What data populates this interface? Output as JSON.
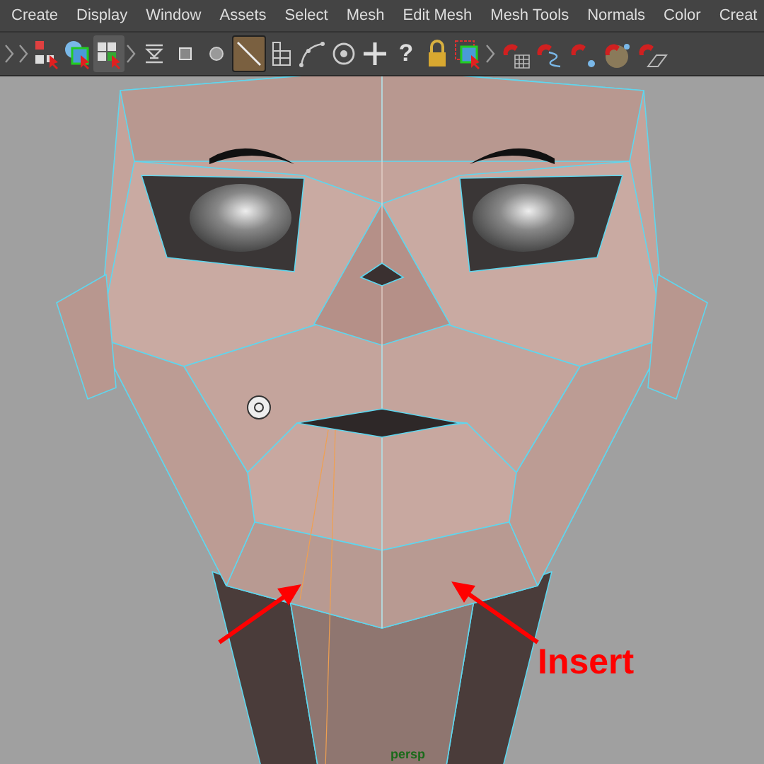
{
  "menu": [
    {
      "label": "Create"
    },
    {
      "label": "Display"
    },
    {
      "label": "Window"
    },
    {
      "label": "Assets"
    },
    {
      "label": "Select"
    },
    {
      "label": "Mesh"
    },
    {
      "label": "Edit Mesh"
    },
    {
      "label": "Mesh Tools"
    },
    {
      "label": "Normals"
    },
    {
      "label": "Color"
    },
    {
      "label": "Creat"
    }
  ],
  "toolbar": [
    {
      "kind": "handle",
      "selected": false
    },
    {
      "kind": "handle",
      "selected": false
    },
    {
      "kind": "hierarchy",
      "selected": false
    },
    {
      "kind": "object",
      "selected": false
    },
    {
      "kind": "component",
      "selected": true
    },
    {
      "kind": "handle",
      "selected": false
    },
    {
      "kind": "slider",
      "selected": false
    },
    {
      "kind": "square",
      "selected": false
    },
    {
      "kind": "circle",
      "selected": false
    },
    {
      "kind": "line",
      "selected": true
    },
    {
      "kind": "grid",
      "selected": false
    },
    {
      "kind": "curve",
      "selected": false
    },
    {
      "kind": "target",
      "selected": false
    },
    {
      "kind": "plus",
      "selected": false
    },
    {
      "kind": "glyph",
      "text": "?",
      "selected": false
    },
    {
      "kind": "lock",
      "selected": false
    },
    {
      "kind": "marquee",
      "selected": false
    },
    {
      "kind": "handle",
      "selected": false
    },
    {
      "kind": "magnet-grid",
      "selected": false
    },
    {
      "kind": "magnet-curve",
      "selected": false
    },
    {
      "kind": "magnet-point",
      "selected": false
    },
    {
      "kind": "magnet-sphere",
      "selected": false
    },
    {
      "kind": "magnet-plane",
      "selected": false
    }
  ],
  "viewport": {
    "annotation": "Insert",
    "camera_label": "persp"
  }
}
